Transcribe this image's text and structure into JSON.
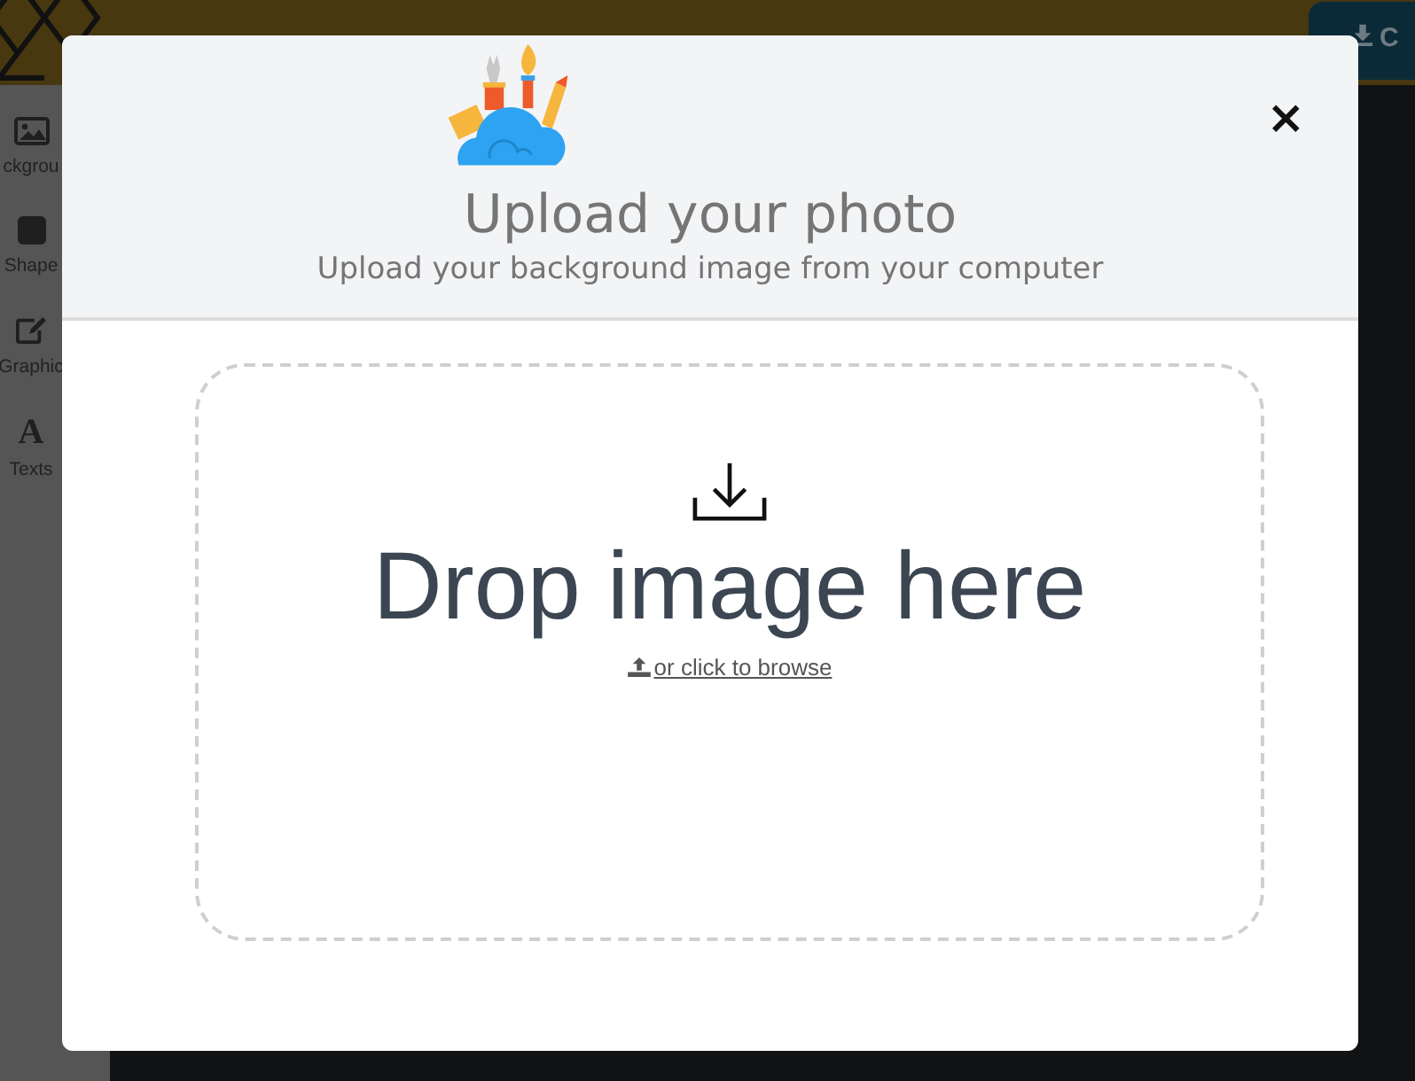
{
  "sidebar": {
    "items": [
      {
        "label": "ckgrou",
        "kind": "image"
      },
      {
        "label": "Shape",
        "kind": "shape"
      },
      {
        "label": "Graphic",
        "kind": "graphic"
      },
      {
        "label": "Texts",
        "kind": "glyph",
        "glyph": "A"
      }
    ]
  },
  "toolbar": {
    "button_label": "C"
  },
  "modal": {
    "title": "Upload your photo",
    "subtitle": "Upload your background image from your computer",
    "close": "×",
    "dropzone": {
      "heading": "Drop image here",
      "link": "or click to browse"
    }
  }
}
